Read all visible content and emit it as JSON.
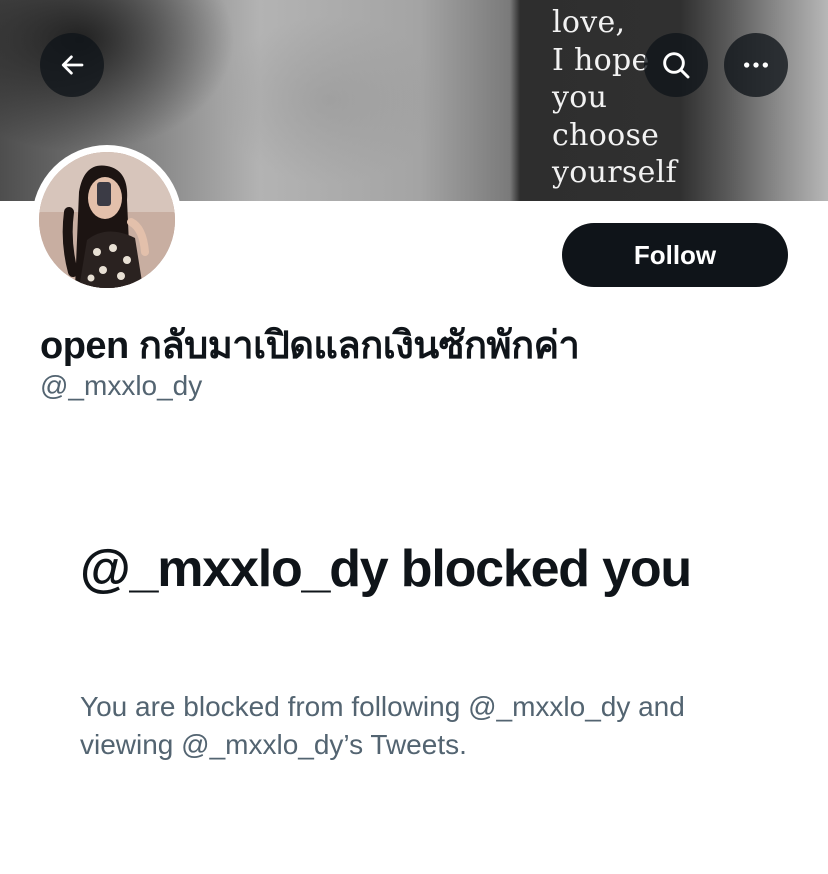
{
  "header": {
    "banner_text": [
      "love,",
      "I hope",
      "you",
      "choose",
      "yourself"
    ],
    "back_icon": "arrow-left-icon",
    "search_icon": "search-icon",
    "more_icon": "more-horizontal-icon"
  },
  "profile": {
    "display_name": "open กลับมาเปิดแลกเงินซักพักค่า",
    "handle": "@_mxxlo_dy",
    "follow_label": "Follow"
  },
  "blocked": {
    "title": "@_mxxlo_dy blocked you",
    "description": "You are blocked from following @_mxxlo_dy and viewing @_mxxlo_dy’s Tweets."
  },
  "colors": {
    "text_primary": "#0f1419",
    "text_secondary": "#536471",
    "button_bg": "#0f1419",
    "background": "#ffffff"
  }
}
